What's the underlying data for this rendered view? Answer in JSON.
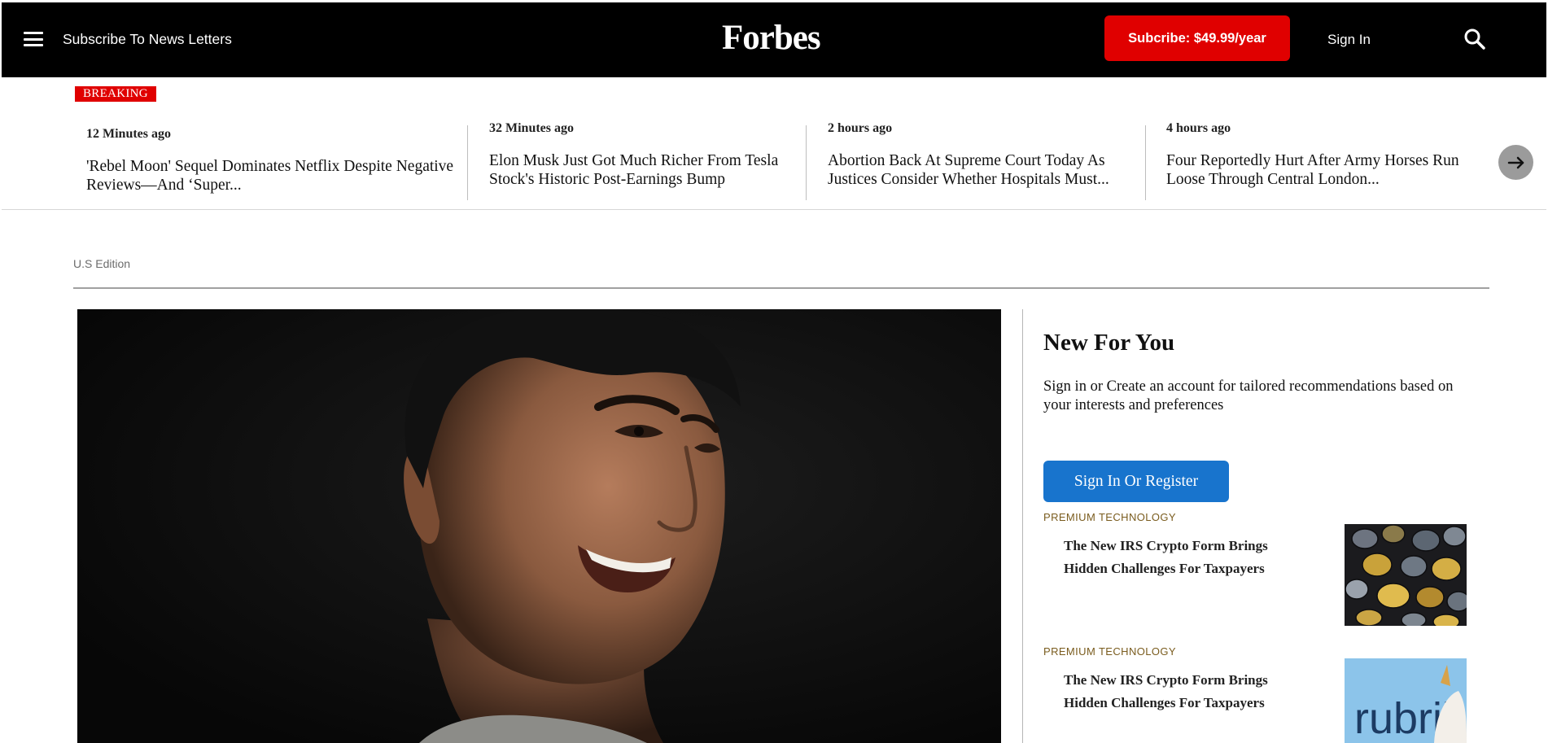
{
  "header": {
    "menu_icon": "hamburger-menu-icon",
    "subscribe_newsletters": "Subscribe To News Letters",
    "logo": "Forbes",
    "subscribe_button": "Subcribe: $49.99/year",
    "sign_in": "Sign In",
    "search_icon": "search-icon"
  },
  "breaking": {
    "badge": "BREAKING",
    "items": [
      {
        "time": "12 Minutes ago",
        "headline": "'Rebel Moon' Sequel Dominates Netflix Despite Negative Reviews—And ‘Super..."
      },
      {
        "time": "32 Minutes ago",
        "headline": "Elon Musk Just Got Much Richer From Tesla Stock's Historic Post-Earnings Bump"
      },
      {
        "time": "2 hours ago",
        "headline": "Abortion Back At Supreme Court Today As Justices Consider Whether Hospitals Must..."
      },
      {
        "time": "4 hours ago",
        "headline": "Four Reportedly Hurt After Army Horses Run Loose Through Central London..."
      }
    ],
    "next_icon": "arrow-right-icon"
  },
  "edition": "U.S Edition",
  "new_for_you": {
    "title": "New For You",
    "description_line1": "Sign in or Create an account for tailored recommendations based on",
    "description_line2": "your interests and preferences",
    "button": "Sign In Or Register",
    "items": [
      {
        "kicker": "PREMIUM TECHNOLOGY",
        "title": "The New IRS Crypto Form Brings Hidden Challenges For Taxpayers",
        "thumb": "crypto-coins-image"
      },
      {
        "kicker": "PREMIUM TECHNOLOGY",
        "title": "The New IRS Crypto Form Brings Hidden Challenges For Taxpayers",
        "thumb": "rubrik-logo-image",
        "thumb_text": "rubrik"
      }
    ]
  },
  "colors": {
    "header_bg": "#000000",
    "subscribe_red": "#e00000",
    "register_blue": "#1874cd",
    "kicker_gold": "#7a5c1e"
  }
}
